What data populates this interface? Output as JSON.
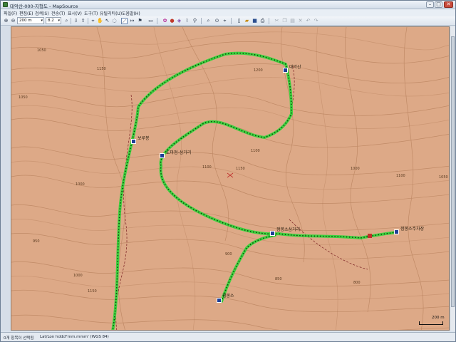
{
  "window": {
    "title": "대악산-000-지형도 - MapSource",
    "minimize": "–",
    "maximize": "□",
    "close": "✕"
  },
  "menu": [
    {
      "label": "파일(F)"
    },
    {
      "label": "편집(E)"
    },
    {
      "label": "검색(S)"
    },
    {
      "label": "전송(T)"
    },
    {
      "label": "표시(V)"
    },
    {
      "label": "도구(T)"
    },
    {
      "label": "유틸리티(U)"
    },
    {
      "label": "도움말(H)"
    }
  ],
  "toolbar": {
    "zoom_value": "200 m",
    "map_value": "8.2"
  },
  "map": {
    "places": [
      {
        "label": "대악산"
      },
      {
        "label": "보루봉"
      },
      {
        "label": "도마점-삼거리"
      },
      {
        "label": "점봉소삼거리"
      },
      {
        "label": "점봉소주차장"
      },
      {
        "label": "점봉소"
      }
    ],
    "contour_labels": [
      "1050",
      "1150",
      "1200",
      "1100",
      "1000",
      "1050",
      "1150",
      "1000",
      "900",
      "1100",
      "950",
      "1000",
      "850",
      "800",
      "1100",
      "1150",
      "1050"
    ],
    "scale_label": "200 m",
    "colors": {
      "terrain": "#dda987",
      "contour": "#a9714c",
      "track": "#3fd13f",
      "track_dot": "#0c3a0c",
      "road": "#7a1f22"
    }
  },
  "status": {
    "selection": "0개 항목이 선택됨",
    "coords": "Lat/Lon hddd°mm.mmm' (WGS 84)"
  }
}
